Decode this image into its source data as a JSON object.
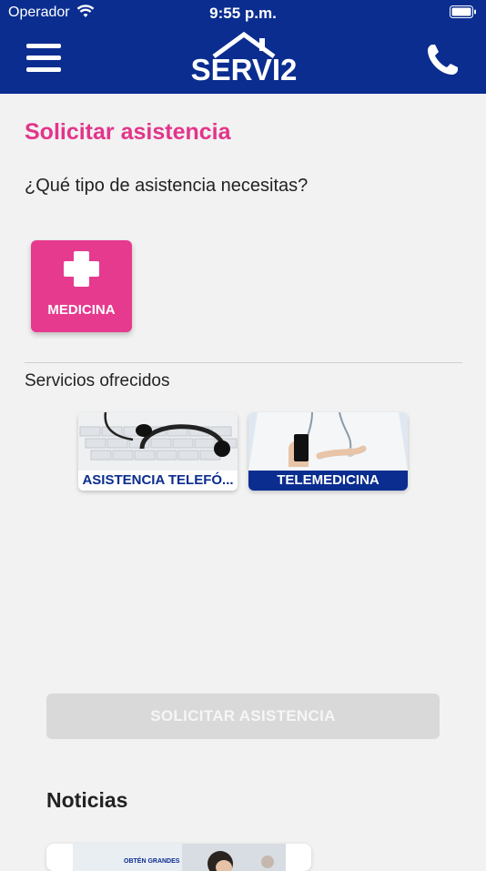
{
  "status_bar": {
    "carrier": "Operador",
    "time": "9:55 p.m."
  },
  "header": {
    "brand": "SERVI2",
    "menu_icon": "hamburger-menu-icon",
    "phone_icon": "phone-icon"
  },
  "page": {
    "title": "Solicitar asistencia",
    "question": "¿Qué tipo de asistencia necesitas?"
  },
  "assistance_types": [
    {
      "label": "MEDICINA",
      "icon": "medical-cross-icon",
      "color": "#e63a8f"
    }
  ],
  "services": {
    "title": "Servicios ofrecidos",
    "items": [
      {
        "label": "ASISTENCIA TELEFÓ...",
        "image": "headset-keyboard-image"
      },
      {
        "label": "TELEMEDICINA",
        "image": "doctor-phone-image"
      }
    ]
  },
  "submit_button": {
    "label": "SOLICITAR ASISTENCIA",
    "state": "disabled"
  },
  "news": {
    "title": "Noticias",
    "items": [
      {
        "banner_text": "OBTÉN GRANDES"
      }
    ]
  },
  "colors": {
    "brand_blue": "#0a2d8f",
    "accent_pink": "#e2358a",
    "background": "#f2f2f2"
  }
}
